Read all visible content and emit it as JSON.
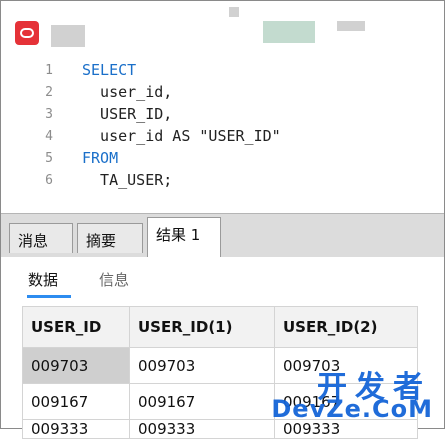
{
  "editor": {
    "line_numbers": [
      "1",
      "2",
      "3",
      "4",
      "5",
      "6"
    ],
    "lines": [
      {
        "kw": "SELECT",
        "text": ""
      },
      {
        "kw": "",
        "text": "  user_id,"
      },
      {
        "kw": "",
        "text": "  USER_ID,"
      },
      {
        "kw": "",
        "text": "  user_id AS \"USER_ID\""
      },
      {
        "kw": "FROM",
        "text": ""
      },
      {
        "kw": "",
        "text": "  TA_USER;"
      }
    ]
  },
  "tabs": {
    "messages": "消息",
    "summary": "摘要",
    "result1": "结果 1"
  },
  "subtabs": {
    "data": "数据",
    "info": "信息"
  },
  "grid": {
    "headers": [
      "USER_ID",
      "USER_ID(1)",
      "USER_ID(2)"
    ],
    "rows": [
      [
        "009703",
        "009703",
        "009703"
      ],
      [
        "009167",
        "009167",
        "009167"
      ],
      [
        "009333",
        "009333",
        "009333"
      ]
    ]
  },
  "watermark": {
    "cn": "开发者",
    "en": "DevZe.CoM"
  },
  "colors": {
    "keyword": "#1a6fc9",
    "accent": "#2d8cf0",
    "logo": "#e53238"
  }
}
